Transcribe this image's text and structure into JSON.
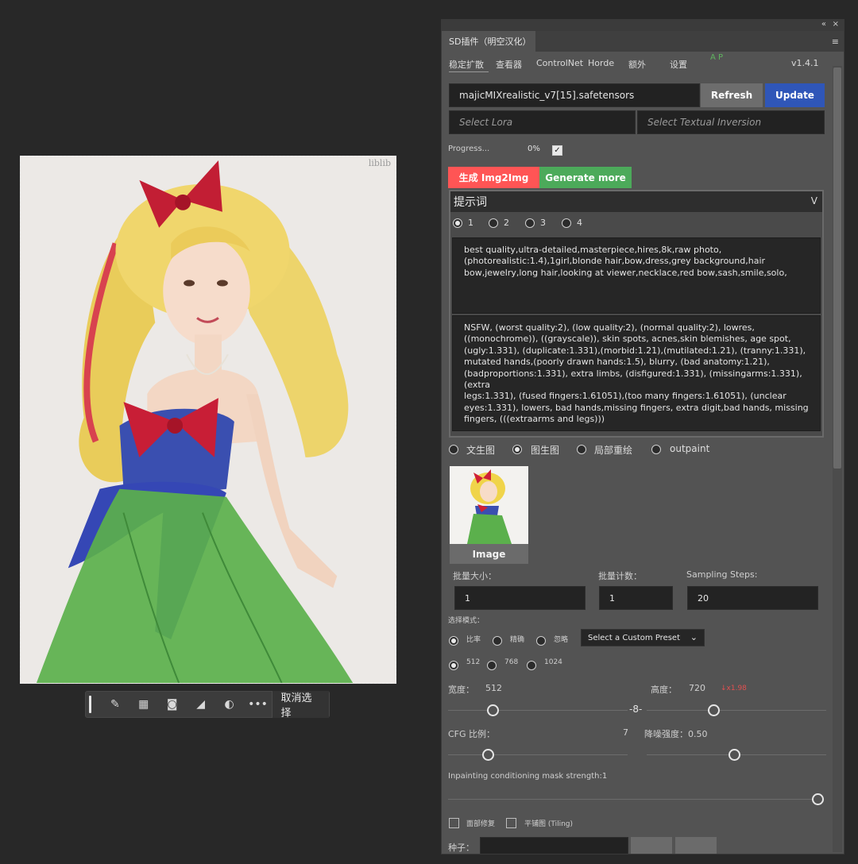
{
  "panel": {
    "window_controls": [
      "«",
      "×"
    ],
    "tab_title": "SD插件（明空汉化）",
    "menu_icon": "hamburger-icon",
    "tabs": [
      "稳定扩散",
      "查看器",
      "ControlNet",
      "Horde",
      "额外",
      "设置"
    ],
    "ap_label": "A P",
    "version": "v1.4.1",
    "model": "majicMIXrealistic_v7[15].safetensors",
    "refresh_label": "Refresh",
    "update_label": "Update",
    "lora_placeholder": "Select Lora",
    "ti_placeholder": "Select Textual Inversion",
    "progress_label": "Progress...",
    "progress_value": "0%",
    "progress_checked": true,
    "generate_label": "生成 Img2Img",
    "generate_more_label": "Generate more",
    "prompt_title": "提示词",
    "prompt_chevron": "V",
    "prompt_slots": [
      "1",
      "2",
      "3",
      "4"
    ],
    "prompt_selected": "1",
    "positive_prompt": "best quality,ultra-detailed,masterpiece,hires,8k,raw photo,\n(photorealistic:1.4),1girl,blonde hair,bow,dress,grey background,hair\nbow,jewelry,long hair,looking at viewer,necklace,red bow,sash,smile,solo,",
    "negative_prompt": "NSFW, (worst quality:2), (low quality:2), (normal quality:2), lowres,\n((monochrome)), ((grayscale)), skin spots, acnes,skin blemishes, age spot,\n(ugly:1.331), (duplicate:1.331),(morbid:1.21),(mutilated:1.21), (tranny:1.331),\nmutated hands,(poorly drawn hands:1.5), blurry, (bad anatomy:1.21),\n(badproportions:1.331), extra limbs, (disfigured:1.331), (missingarms:1.331),(extra\nlegs:1.331), (fused fingers:1.61051),(too many fingers:1.61051), (unclear\neyes:1.331), lowers, bad hands,missing fingers, extra digit,bad hands, missing\nfingers, (((extraarms and legs)))",
    "modes": [
      "文生图",
      "图生图",
      "局部重绘",
      "outpaint"
    ],
    "mode_selected": "图生图",
    "image_button": "Image",
    "batch_size_label": "批量大小：",
    "batch_count_label": "批量计数：",
    "steps_label": "Sampling Steps:",
    "batch_size": "1",
    "batch_count": "1",
    "steps": "20",
    "select_mode_label": "选择模式：",
    "ratio_options": [
      "比率",
      "精确",
      "忽略"
    ],
    "preset_label": "Select a Custom Preset",
    "res_options": [
      "512",
      "768",
      "1024"
    ],
    "width_label": "宽度：",
    "width_value": "512",
    "height_label": "高度：",
    "height_value": "720",
    "scale_note": "↓x1.98",
    "cfg_label": "CFG 比例：",
    "cfg_value": "7",
    "denoise_label": "降噪强度：0.50",
    "mask_label": "Inpainting conditioning mask strength:1",
    "face_fix_label": "面部修复",
    "tiling_label": "平铺图 (Tiling)",
    "seed_label": "种子："
  },
  "canvas": {
    "watermark": "liblib"
  },
  "context_bar": {
    "icons": [
      "brush-icon",
      "checker-icon",
      "mask-icon",
      "fill-icon",
      "contrast-icon",
      "more-icon"
    ],
    "deselect_label": "取消选择"
  },
  "colors": {
    "generate": "#ff5555",
    "generate_more": "#4caa5a",
    "update": "#2f56b8",
    "refresh": "#6d6d6d",
    "scale_note": "#e05050"
  }
}
